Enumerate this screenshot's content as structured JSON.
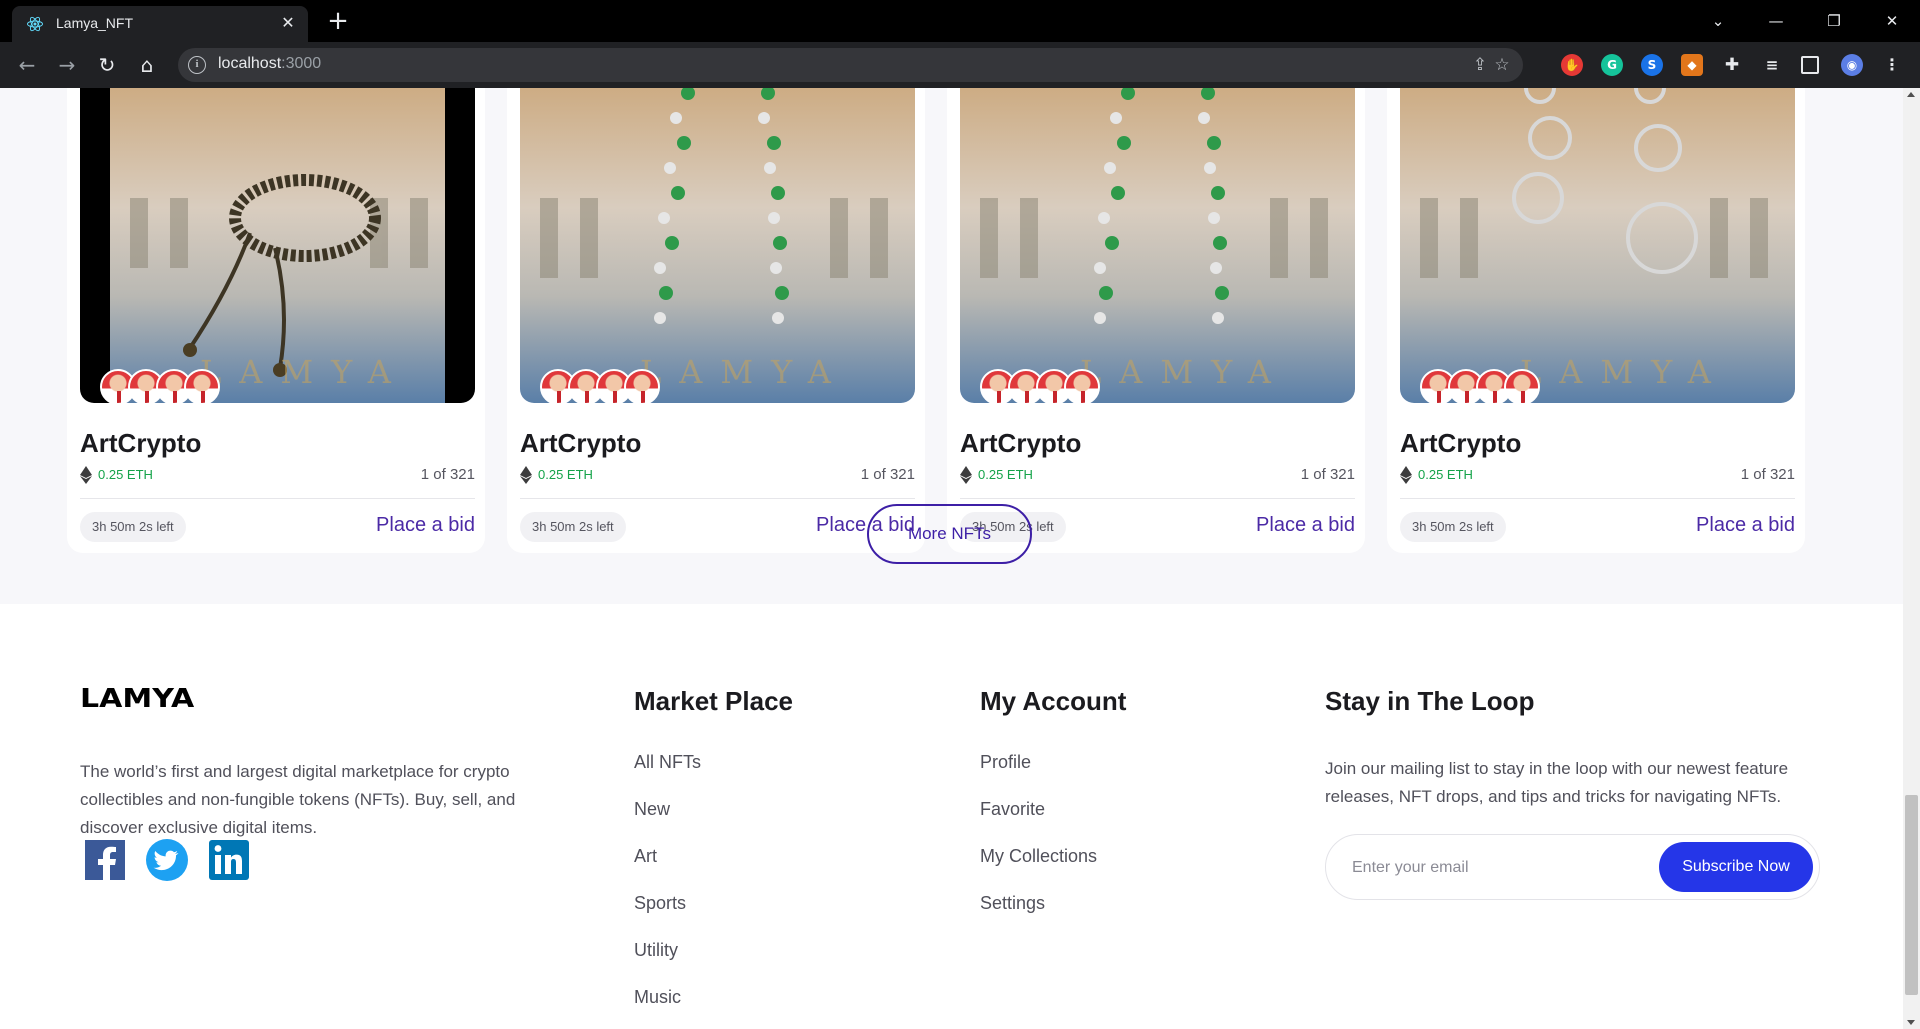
{
  "browser": {
    "tab_title": "Lamya_NFT",
    "tab_close": "✕",
    "new_tab": "+",
    "url_host": "localhost",
    "url_port": ":3000",
    "window_controls": [
      "⌄",
      "—",
      "❐",
      "✕"
    ]
  },
  "cards": [
    {
      "title": "ArtCrypto",
      "price": "0.25 ETH",
      "edition": "1 of 321",
      "time_left": "3h 50m 2s left",
      "bid_label": "Place a bid",
      "image": "bracelet"
    },
    {
      "title": "ArtCrypto",
      "price": "0.25 ETH",
      "edition": "1 of 321",
      "time_left": "3h 50m 2s left",
      "bid_label": "Place a bid",
      "image": "emerald-earrings"
    },
    {
      "title": "ArtCrypto",
      "price": "0.25 ETH",
      "edition": "1 of 321",
      "time_left": "3h 50m 2s left",
      "bid_label": "Place a bid",
      "image": "emerald-earrings"
    },
    {
      "title": "ArtCrypto",
      "price": "0.25 ETH",
      "edition": "1 of 321",
      "time_left": "3h 50m 2s left",
      "bid_label": "Place a bid",
      "image": "diamond-earrings"
    }
  ],
  "more_button": "More NFTs",
  "footer": {
    "logo": "LAMYA",
    "about": "The world’s first and largest digital marketplace for crypto collectibles and non-fungible tokens (NFTs). Buy, sell, and discover exclusive digital items.",
    "social": [
      "facebook-icon",
      "twitter-icon",
      "linkedin-icon"
    ],
    "marketplace": {
      "title": "Market Place",
      "links": [
        "All NFTs",
        "New",
        "Art",
        "Sports",
        "Utility",
        "Music"
      ]
    },
    "account": {
      "title": "My Account",
      "links": [
        "Profile",
        "Favorite",
        "My Collections",
        "Settings"
      ]
    },
    "loop": {
      "title": "Stay in The Loop",
      "text": "Join our mailing list to stay in the loop with our newest feature releases, NFT drops, and tips and tricks for navigating NFTs.",
      "email_placeholder": "Enter your email",
      "button": "Subscribe Now"
    }
  },
  "colors": {
    "accent_purple": "#3d1fa6",
    "subscribe_blue": "#2536e8",
    "price_green": "#15a34a"
  }
}
